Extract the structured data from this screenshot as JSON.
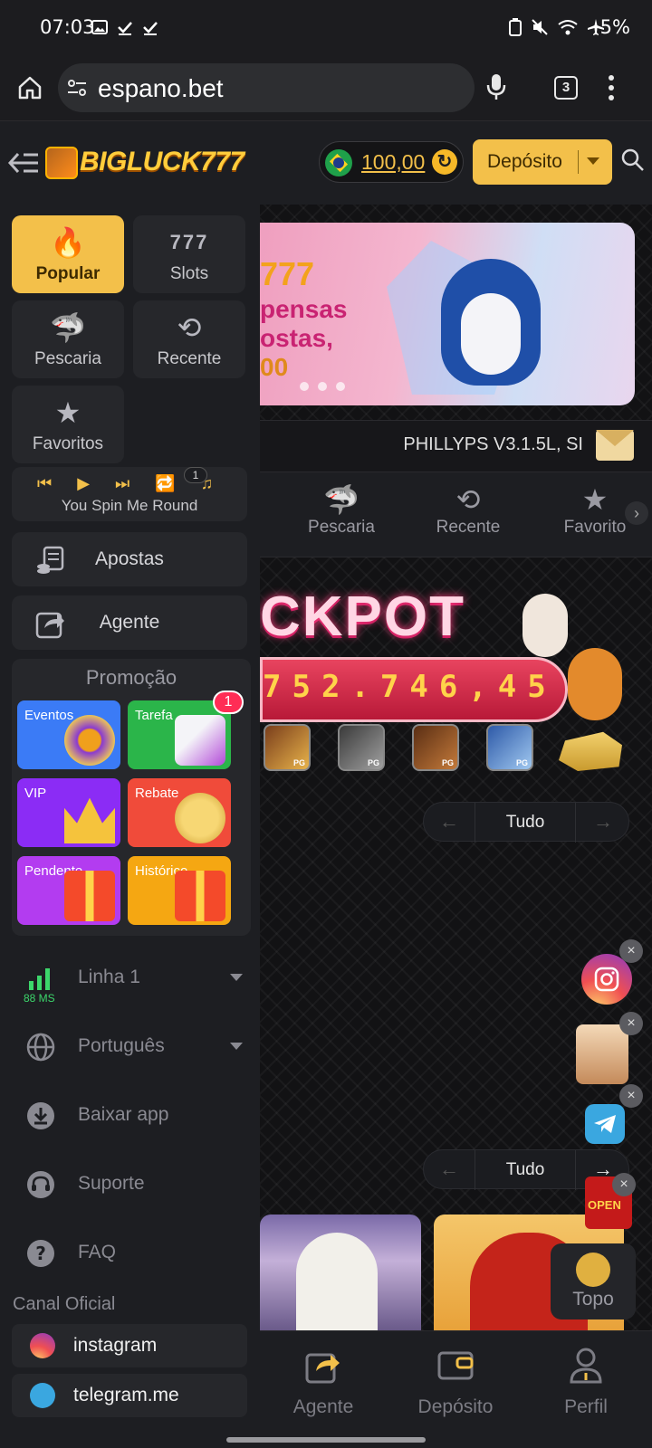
{
  "status_bar": {
    "time": "07:03",
    "battery": "5%"
  },
  "browser": {
    "url": "espano.bet",
    "tab_count": "3"
  },
  "header": {
    "brand": "BIGLUCK777",
    "balance": "100,00",
    "deposit_label": "Depósito"
  },
  "sidebar": {
    "categories": [
      {
        "label": "Popular",
        "icon": "fire-icon"
      },
      {
        "label": "Slots",
        "icon": "slots-777-icon"
      },
      {
        "label": "Pescaria",
        "icon": "shark-icon"
      },
      {
        "label": "Recente",
        "icon": "history-icon"
      },
      {
        "label": "Favoritos",
        "icon": "star-icon"
      }
    ],
    "player": {
      "song": "You Spin Me Round",
      "queue_count": "1"
    },
    "menu": [
      {
        "label": "Apostas",
        "icon": "bets-icon"
      },
      {
        "label": "Agente",
        "icon": "share-icon"
      }
    ],
    "promo": {
      "title": "Promoção",
      "items": [
        {
          "label": "Eventos",
          "color": "#3b7bf6"
        },
        {
          "label": "Tarefa",
          "color": "#2bb54a",
          "badge": "1"
        },
        {
          "label": "VIP",
          "color": "#8b2cf5"
        },
        {
          "label": "Rebate",
          "color": "#f04b3a"
        },
        {
          "label": "Pendente",
          "color": "#b33cf0"
        },
        {
          "label": "Histórico",
          "color": "#f5a712"
        }
      ]
    },
    "settings": [
      {
        "label": "Linha 1",
        "sub": "88 MS",
        "icon": "signal-icon"
      },
      {
        "label": "Português",
        "icon": "globe-icon"
      },
      {
        "label": "Baixar app",
        "icon": "download-icon"
      },
      {
        "label": "Suporte",
        "icon": "headset-icon"
      },
      {
        "label": "FAQ",
        "icon": "question-icon"
      }
    ],
    "canal_title": "Canal Oficial",
    "social": [
      {
        "label": "instagram",
        "icon": "instagram-icon"
      },
      {
        "label": "telegram.me",
        "icon": "telegram-icon"
      }
    ]
  },
  "main": {
    "banner_lines": [
      "777",
      "pensas",
      "ostas,",
      "00"
    ],
    "marquee": "PHILLYPS V3.1.5L, SI",
    "categories": [
      {
        "label": "Pescaria",
        "icon": "shark-icon"
      },
      {
        "label": "Recente",
        "icon": "history-icon"
      },
      {
        "label": "Favorito",
        "icon": "star-icon"
      }
    ],
    "jackpot_title": "CKPOT",
    "jackpot_value": "752.746,45",
    "thumb_tag": "PG",
    "pager_label": "Tudo",
    "pager2_label": "Tudo",
    "open_label": "OPEN",
    "topo_label": "Topo"
  },
  "bottom_nav": [
    {
      "label": "Agente",
      "icon": "share-icon"
    },
    {
      "label": "Depósito",
      "icon": "wallet-icon"
    },
    {
      "label": "Perfil",
      "icon": "user-icon"
    }
  ]
}
